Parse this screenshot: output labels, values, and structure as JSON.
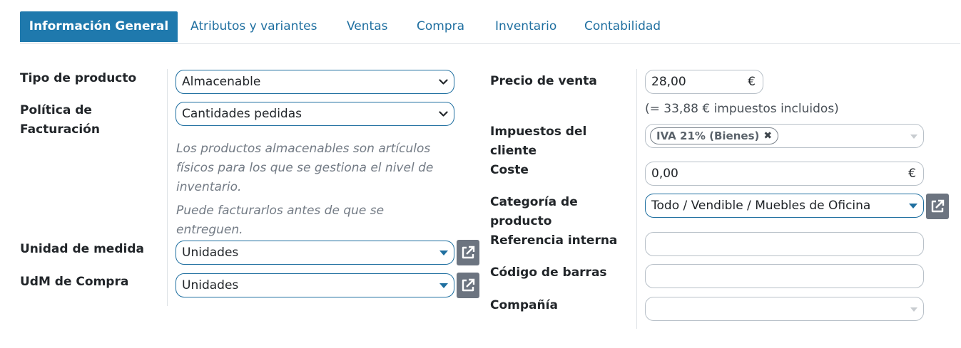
{
  "tabs": [
    {
      "label": "Información General",
      "active": true
    },
    {
      "label": "Atributos y variantes"
    },
    {
      "label": "Ventas"
    },
    {
      "label": "Compra"
    },
    {
      "label": "Inventario"
    },
    {
      "label": "Contabilidad"
    }
  ],
  "left": {
    "product_type": {
      "label": "Tipo de producto",
      "value": "Almacenable"
    },
    "invoicing_policy": {
      "label_line1": "Política de",
      "label_line2": "Facturación",
      "value": "Cantidades pedidas"
    },
    "help_storable": [
      "Los productos almacenables son artículos",
      "físicos para los que se gestiona el nivel de",
      "inventario."
    ],
    "help_invoice": [
      "Puede facturarlos antes de que se",
      "entreguen."
    ],
    "uom": {
      "label": "Unidad de medida",
      "value": "Unidades"
    },
    "purchase_uom": {
      "label": "UdM de Compra",
      "value": "Unidades"
    }
  },
  "right": {
    "sale_price": {
      "label": "Precio de venta",
      "value": "28,00",
      "currency": "€",
      "taxes_note": "(= 33,88 € impuestos incluidos)"
    },
    "customer_taxes": {
      "label_line1": "Impuestos del",
      "label_line2": "cliente",
      "tag": "IVA 21% (Bienes)"
    },
    "cost": {
      "label": "Coste",
      "value": "0,00",
      "currency": "€"
    },
    "category": {
      "label_line1": "Categoría de",
      "label_line2": "producto",
      "value": "Todo / Vendible / Muebles de Oficina"
    },
    "internal_ref": {
      "label": "Referencia interna",
      "value": ""
    },
    "barcode": {
      "label": "Código de barras",
      "value": ""
    },
    "company": {
      "label": "Compañía",
      "value": ""
    }
  },
  "icons": {
    "chevron": "chevron-down-icon",
    "external": "external-link-icon",
    "remove": "remove-tag-icon"
  },
  "colors": {
    "accent": "#1f79ad",
    "link": "#1f6fa0",
    "button_grey": "#6c7480"
  }
}
